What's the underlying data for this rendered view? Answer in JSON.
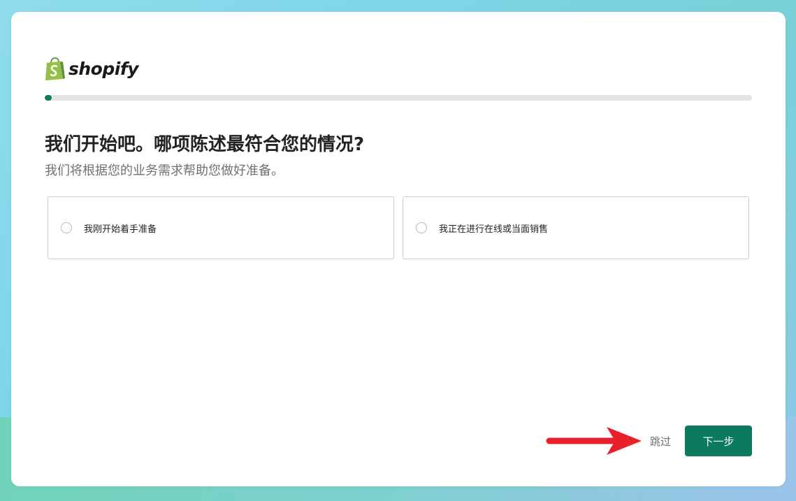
{
  "brand": {
    "name": "shopify",
    "logo_icon": "shopify-bag-icon",
    "colors": {
      "bag_green": "#95bf47",
      "bag_dark": "#5e8e3e",
      "accent": "#0b7a5e"
    }
  },
  "progress": {
    "value_percent": 1
  },
  "question": {
    "title": "我们开始吧。哪项陈述最符合您的情况?",
    "subtitle": "我们将根据您的业务需求帮助您做好准备。"
  },
  "options": [
    {
      "label": "我刚开始着手准备",
      "selected": false
    },
    {
      "label": "我正在进行在线或当面销售",
      "selected": false
    }
  ],
  "footer": {
    "skip_label": "跳过",
    "next_label": "下一步",
    "arrow_icon": "red-arrow-right-icon",
    "arrow_color": "#e8202a"
  }
}
